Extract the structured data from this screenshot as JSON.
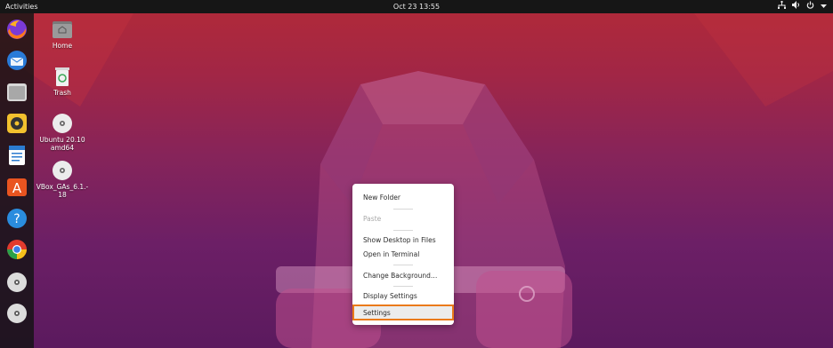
{
  "topbar": {
    "activities": "Activities",
    "clock": "Oct 23  13:55"
  },
  "desktop": {
    "icons": [
      {
        "label": "Home"
      },
      {
        "label": "Trash"
      },
      {
        "label_line1": "Ubuntu 20.10",
        "label_line2": "amd64"
      },
      {
        "label_line1": "VBox_GAs_6.1.-",
        "label_line2": "18"
      }
    ]
  },
  "dock": {
    "items": [
      "firefox-icon",
      "thunderbird-icon",
      "files-icon",
      "rhythmbox-icon",
      "libreoffice-writer-icon",
      "software-center-icon",
      "help-icon",
      "chrome-icon",
      "disc-icon",
      "disc-icon"
    ]
  },
  "context_menu": {
    "items": [
      {
        "label": "New Folder",
        "enabled": true
      },
      {
        "label": "Paste",
        "enabled": false
      },
      {
        "label": "Show Desktop in Files",
        "enabled": true
      },
      {
        "label": "Open in Terminal",
        "enabled": true
      },
      {
        "label": "Change Background…",
        "enabled": true
      },
      {
        "label": "Display Settings",
        "enabled": true
      },
      {
        "label": "Settings",
        "enabled": true,
        "highlighted": true
      }
    ],
    "highlight_color": "#ea7a1a"
  }
}
